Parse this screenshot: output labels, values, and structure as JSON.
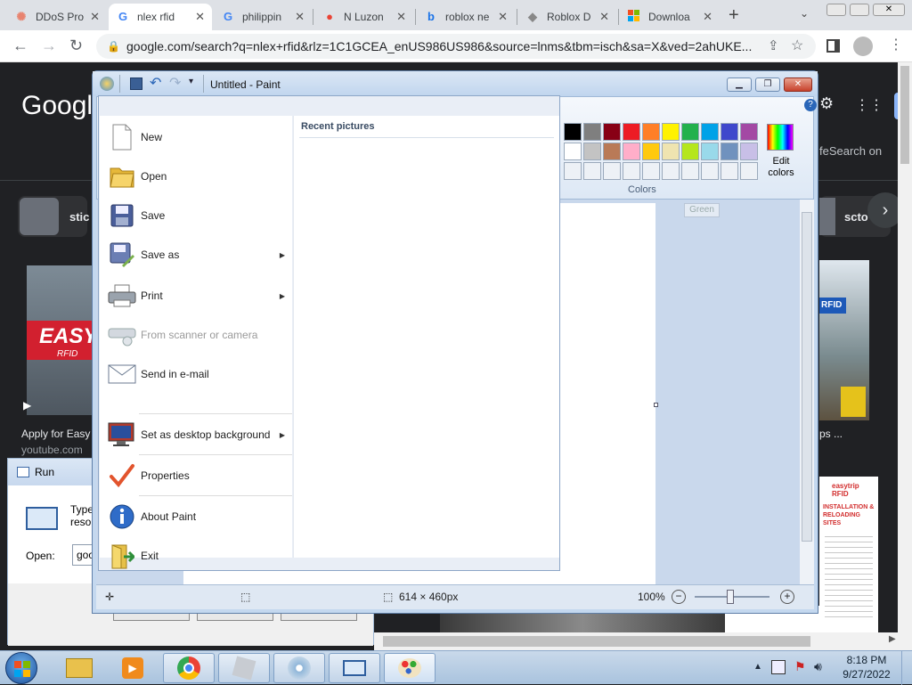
{
  "browser": {
    "tabs": [
      {
        "label": "DDoS Pro",
        "icon": "ddos-favicon-icon",
        "active": false
      },
      {
        "label": "nlex rfid",
        "icon": "google-icon",
        "active": true
      },
      {
        "label": "philippin",
        "icon": "google-icon",
        "active": false
      },
      {
        "label": "N Luzon",
        "icon": "maps-pin-icon",
        "active": false
      },
      {
        "label": "roblox ne",
        "icon": "bing-icon",
        "active": false
      },
      {
        "label": "Roblox D",
        "icon": "roblox-icon",
        "active": false
      },
      {
        "label": "Downloa",
        "icon": "microsoft-icon",
        "active": false
      }
    ],
    "url": "google.com/search?q=nlex+rfid&rlz=1C1GCEA_enUS986US986&source=lnms&tbm=isch&sa=X&ved=2ahUKE...",
    "new_tab": "+"
  },
  "google": {
    "logo": "Googl",
    "safesearch": "feSearch on",
    "chip_left": "stic",
    "chip_right": "scto",
    "result_title": "Apply for Easy",
    "result_source": "youtube.com",
    "right_result_title": "ps ...",
    "tooltip": "Green",
    "thumb_text": "EASYT",
    "thumb_sub": "RFID",
    "rfid_sign": "RFID",
    "easytrip_title": "easytrip RFID",
    "easytrip_sub": "INSTALLATION & RELOADING SITES"
  },
  "run_dialog": {
    "title": "Run",
    "prompt_line1": "Type",
    "prompt_line2": "reso",
    "open_label": "Open:",
    "open_value": "goo"
  },
  "paint": {
    "title": "Untitled - Paint",
    "colors_label": "Colors",
    "edit_colors_line1": "Edit",
    "edit_colors_line2": "colors",
    "swatches_row1": [
      "#000000",
      "#7f7f7f",
      "#880015",
      "#ed1c24",
      "#ff7f27",
      "#fff200",
      "#22b14c",
      "#00a2e8",
      "#3f48cc",
      "#a349a4"
    ],
    "swatches_row2": [
      "#ffffff",
      "#c3c3c3",
      "#b97a57",
      "#ffaec9",
      "#ffc90e",
      "#efe4b0",
      "#b5e61d",
      "#99d9ea",
      "#7092be",
      "#c8bfe7"
    ],
    "status_size": "614 × 460px",
    "zoom": "100%",
    "menu": {
      "recent_title": "Recent pictures",
      "items": [
        {
          "label": "New",
          "icon": "new-file-icon",
          "submenu": false,
          "disabled": false
        },
        {
          "label": "Open",
          "icon": "open-folder-icon",
          "submenu": false,
          "disabled": false
        },
        {
          "label": "Save",
          "icon": "save-disk-icon",
          "submenu": false,
          "disabled": false
        },
        {
          "label": "Save as",
          "icon": "save-as-icon",
          "submenu": true,
          "disabled": false
        },
        {
          "label": "Print",
          "icon": "printer-icon",
          "submenu": true,
          "disabled": false
        },
        {
          "label": "From scanner or camera",
          "icon": "scanner-icon",
          "submenu": false,
          "disabled": true
        },
        {
          "label": "Send in e-mail",
          "icon": "email-icon",
          "submenu": false,
          "disabled": false
        },
        {
          "label": "Set as desktop background",
          "icon": "desktop-background-icon",
          "submenu": true,
          "disabled": false
        },
        {
          "label": "Properties",
          "icon": "properties-check-icon",
          "submenu": false,
          "disabled": false
        },
        {
          "label": "About Paint",
          "icon": "info-icon",
          "submenu": false,
          "disabled": false
        },
        {
          "label": "Exit",
          "icon": "exit-icon",
          "submenu": false,
          "disabled": false
        }
      ]
    }
  },
  "taskbar": {
    "time": "8:18 PM",
    "date": "9/27/2022"
  }
}
